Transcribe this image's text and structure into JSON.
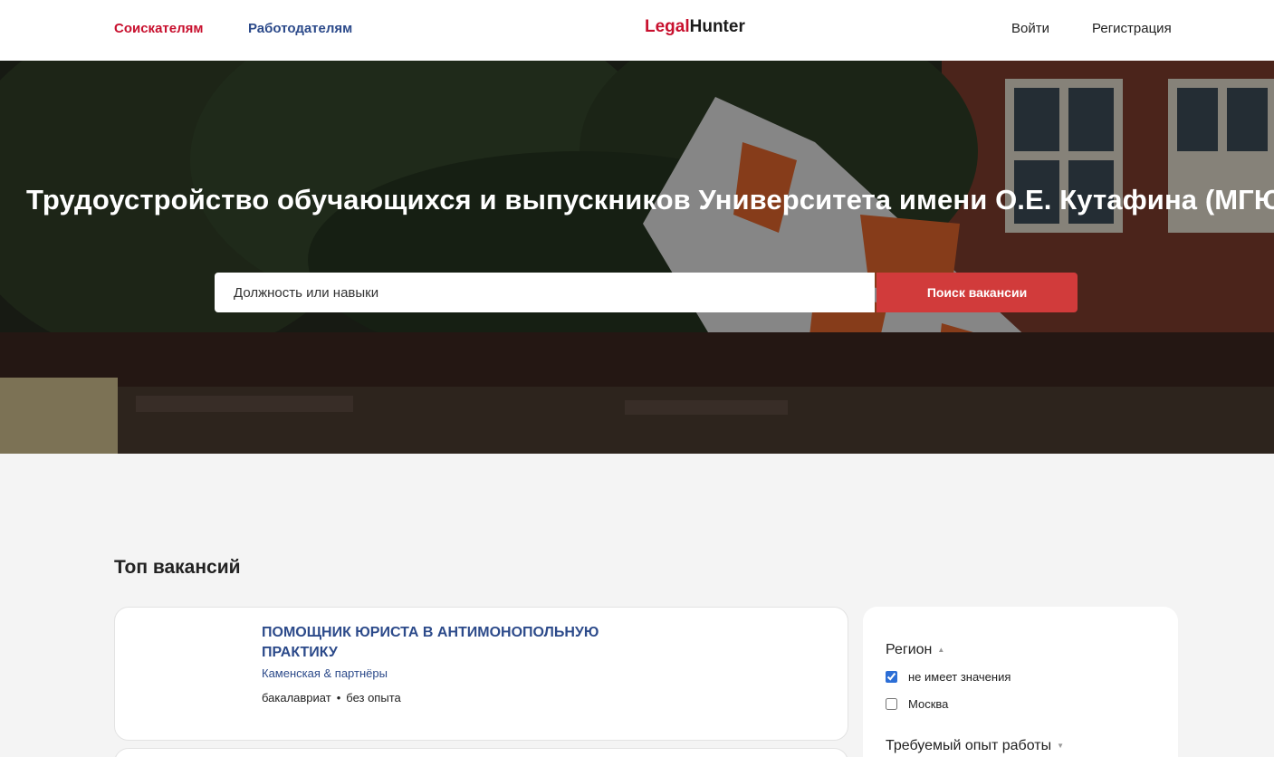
{
  "header": {
    "nav_seekers": "Соискателям",
    "nav_employers": "Работодателям",
    "logo_part1": "Legal",
    "logo_part2": "Hunter",
    "login": "Войти",
    "register": "Регистрация"
  },
  "hero": {
    "title": "Трудоустройство обучающихся и выпускников Университета имени О.Е. Кутафина (МГЮА)",
    "search_placeholder": "Должность или навыки",
    "search_button": "Поиск вакансии"
  },
  "main": {
    "section_title": "Топ вакансий",
    "vacancies": [
      {
        "title": "Помощник юриста в антимонопольную практику",
        "company": "Каменская & партнёры",
        "education": "бакалавриат",
        "experience": "без опыта"
      }
    ]
  },
  "filters": {
    "region": {
      "heading": "Регион",
      "options": [
        {
          "label": "не имеет значения",
          "checked": true
        },
        {
          "label": "Москва",
          "checked": false
        }
      ]
    },
    "experience": {
      "heading": "Требуемый опыт работы"
    }
  },
  "colors": {
    "accent_red": "#c8102e",
    "link_blue": "#2c4a8a",
    "search_button": "#d13b3b"
  }
}
